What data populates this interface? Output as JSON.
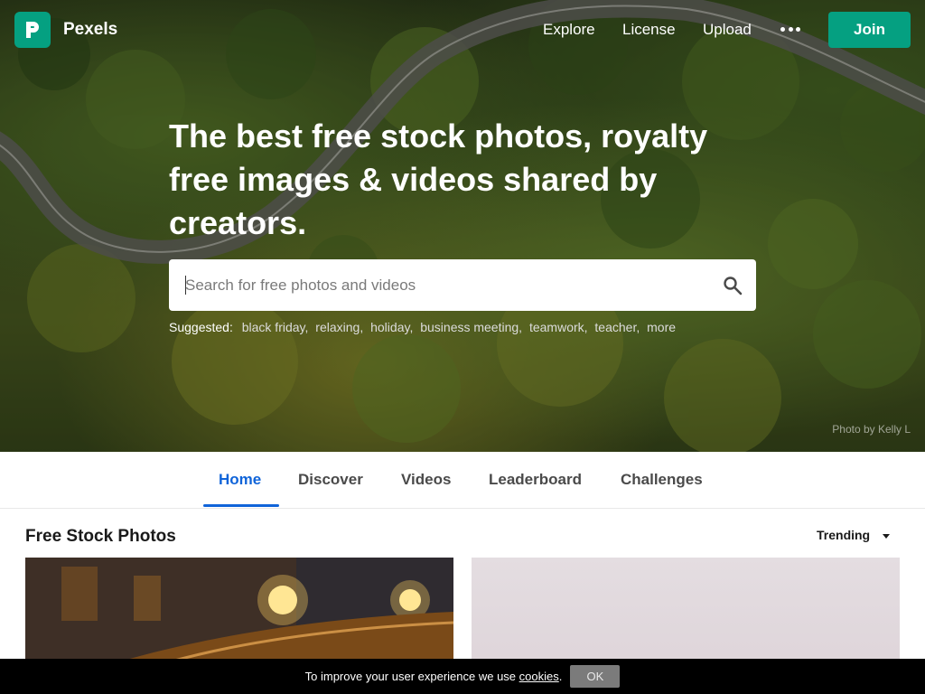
{
  "nav": {
    "brand": "Pexels",
    "links": [
      "Explore",
      "License",
      "Upload"
    ],
    "more_icon": "ellipsis-icon",
    "join_label": "Join"
  },
  "hero": {
    "headline": "The best free stock photos, royalty free images & videos shared by creators.",
    "search_placeholder": "Search for free photos and videos",
    "search_icon": "search-icon",
    "suggested_label": "Suggested:",
    "suggestions": [
      "black friday",
      "relaxing",
      "holiday",
      "business meeting",
      "teamwork",
      "teacher",
      "more"
    ],
    "credit": "Photo by Kelly L"
  },
  "tabs": [
    "Home",
    "Discover",
    "Videos",
    "Leaderboard",
    "Challenges"
  ],
  "active_tab": "Home",
  "section": {
    "title": "Free Stock Photos",
    "sort_label": "Trending"
  },
  "cookie": {
    "text_before": "To improve your user experience we use ",
    "link": "cookies",
    "text_after": ".",
    "ok_label": "OK"
  },
  "colors": {
    "brand_green": "#05a081",
    "active_blue": "#1064d9"
  }
}
